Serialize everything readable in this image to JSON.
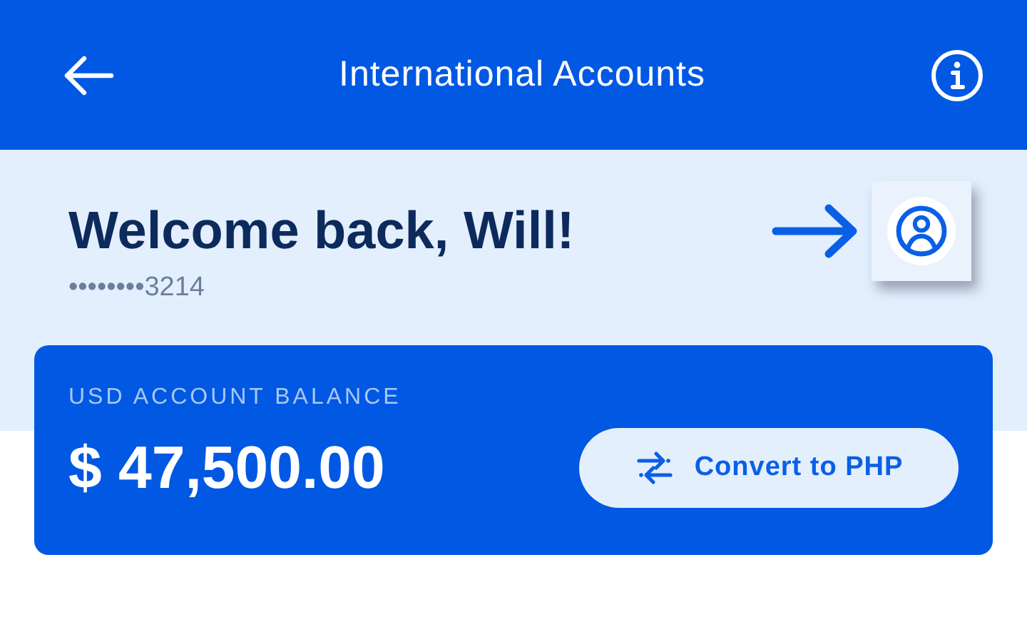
{
  "header": {
    "title": "International Accounts"
  },
  "welcome": {
    "greeting": "Welcome back, Will!",
    "account_number": "••••••••3214"
  },
  "balance_card": {
    "label": "USD ACCOUNT BALANCE",
    "amount": "$ 47,500.00",
    "button": "Convert to PHP"
  }
}
